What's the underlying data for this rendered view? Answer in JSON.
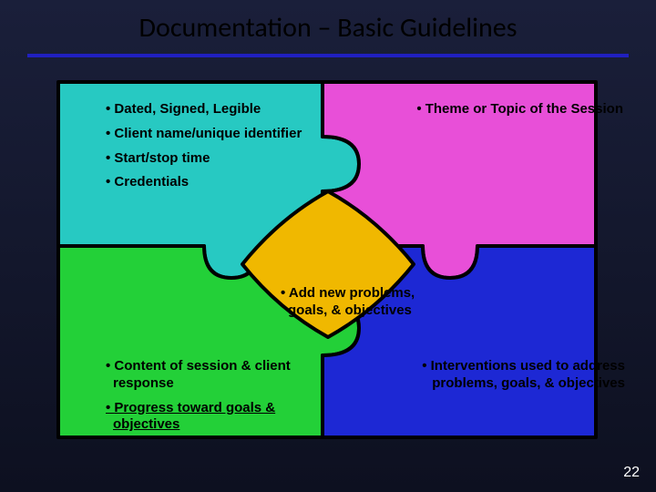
{
  "slide": {
    "title": "Documentation – Basic Guidelines",
    "number": "22"
  },
  "colors": {
    "tl": "#27c9c2",
    "tr": "#e84fd8",
    "bl": "#23d038",
    "br": "#1d28d4",
    "center": "#f0b800",
    "outline": "#000000"
  },
  "bullets": {
    "tl": [
      {
        "text": "Dated, Signed, Legible"
      },
      {
        "text": "Client name/unique identifier"
      },
      {
        "text": "Start/stop time"
      },
      {
        "text": "Credentials"
      }
    ],
    "tr": [
      {
        "text": "Theme or Topic of the Session"
      }
    ],
    "center": [
      {
        "text": "Add new problems, goals, & objectives"
      }
    ],
    "bl": [
      {
        "text": "Content of session & client response"
      },
      {
        "text": "Progress toward goals & objectives",
        "underline": true
      }
    ],
    "br": [
      {
        "text": "Interventions used to address problems, goals, & objectives"
      }
    ]
  }
}
